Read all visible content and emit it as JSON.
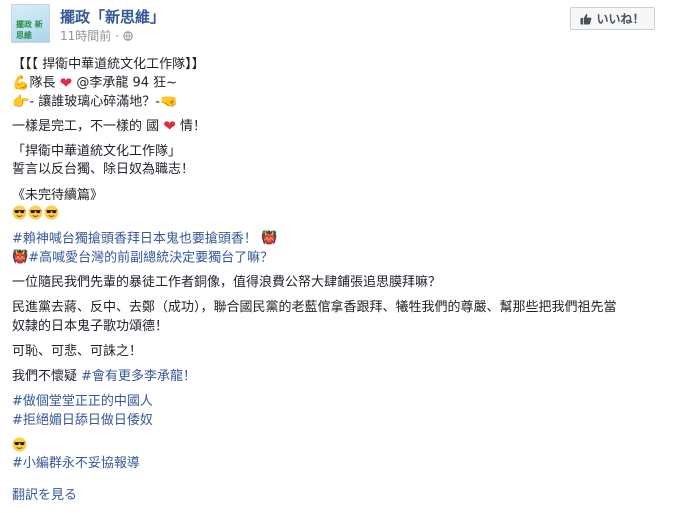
{
  "header": {
    "page_name": "擺政「新思維」",
    "time": "11時間前",
    "separator": "·",
    "avatar_text": "擺政 新思維",
    "like_label": "いいね！"
  },
  "post": {
    "lines": [
      "【【【 捍衛中華道統文化工作隊】】",
      "隊長",
      "@李承龍 94 狂~",
      "- 讓誰玻璃心碎滿地？-",
      "一樣是完工，不一樣的 國",
      "情！",
      "「捍衛中華道統文化工作隊」",
      "誓言以反台獨、除日奴為職志！",
      "《未完待續篇》",
      "#賴神喊台獨搶頭香拜日本鬼也要搶頭香！",
      "#高喊愛台灣的前副總統決定要獨台了嘛？",
      "一位隨民我們先輩的暴徒工作者銅像，值得浪費公帑大肆鋪張追思膜拜嘛？",
      "民進黨去蔣、反中、去鄭（成功），聯合國民黨的老藍倌拿香跟拜、犧牲我們的尊嚴、幫那些把我們祖先當",
      "奴隸的日本鬼子歌功頌德！",
      "可恥、可悲、可誅之！",
      "我們不懷疑",
      "#會有更多李承龍！",
      "#做個堂堂正正的中國人",
      "#拒絕媚日舔日做日倭奴",
      "#小編群永不妥協報導"
    ],
    "translate_label": "翻訳を見る"
  },
  "icons": {
    "heart": "❤",
    "point_right": "👉",
    "point_left": "🤜",
    "muscle": "💪",
    "sunglasses": "😎",
    "ogre": "👹"
  },
  "colors": {
    "link": "#365899",
    "text": "#1d2129",
    "meta": "#90949c",
    "heart": "#dd2e44"
  }
}
